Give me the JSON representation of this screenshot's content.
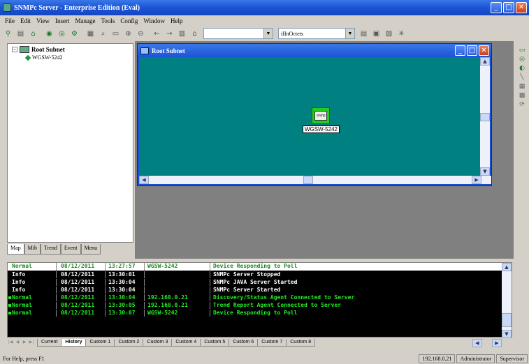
{
  "window": {
    "title": "SNMPc Server - Enterprise Edition (Eval)"
  },
  "menu": [
    "File",
    "Edit",
    "View",
    "Insert",
    "Manage",
    "Tools",
    "Config",
    "Window",
    "Help"
  ],
  "toolbar": {
    "combo1_value": "",
    "combo2_value": "ifInOctets"
  },
  "tree": {
    "root": "Root Subnet",
    "child": "WGSW-5242"
  },
  "left_tabs": [
    "Map",
    "Mib",
    "Trend",
    "Event",
    "Menu"
  ],
  "map_window": {
    "title": "Root Subnet",
    "device_label": "WGSW-5242",
    "device_icon_text": "snmp"
  },
  "events": {
    "header": {
      "severity": "Normal",
      "date": "08/12/2011",
      "time": "13:27:57",
      "source": "WGSW-5242",
      "message": "Device Responding to Poll"
    },
    "rows": [
      {
        "severity": "Info",
        "date": "08/12/2011",
        "time": "13:30:01",
        "source": "",
        "message": "SNMPc Server Stopped",
        "style": "white"
      },
      {
        "severity": "Info",
        "date": "08/12/2011",
        "time": "13:30:04",
        "source": "",
        "message": "SNMPc JAVA Server Started",
        "style": "white"
      },
      {
        "severity": "Info",
        "date": "08/12/2011",
        "time": "13:30:04",
        "source": "",
        "message": "SNMPc Server Started",
        "style": "white"
      },
      {
        "severity": "Normal",
        "date": "08/12/2011",
        "time": "13:30:04",
        "source": "192.168.0.21",
        "message": "Discovery/Status Agent Connected to Server",
        "style": "green"
      },
      {
        "severity": "Normal",
        "date": "08/12/2011",
        "time": "13:30:05",
        "source": "192.168.0.21",
        "message": "Trend Report Agent Connected to Server",
        "style": "green"
      },
      {
        "severity": "Normal",
        "date": "08/12/2011",
        "time": "13:30:07",
        "source": "WGSW-5242",
        "message": "Device Responding to Poll",
        "style": "green"
      }
    ]
  },
  "event_tabs": [
    "Current",
    "History",
    "Custom 1",
    "Custom 2",
    "Custom 3",
    "Custom 4",
    "Custom 5",
    "Custom 6",
    "Custom 7",
    "Custom 8"
  ],
  "status": {
    "help": "For Help, press F1",
    "ip": "192.168.0.21",
    "user": "Administrator",
    "role": "Supervisor"
  }
}
